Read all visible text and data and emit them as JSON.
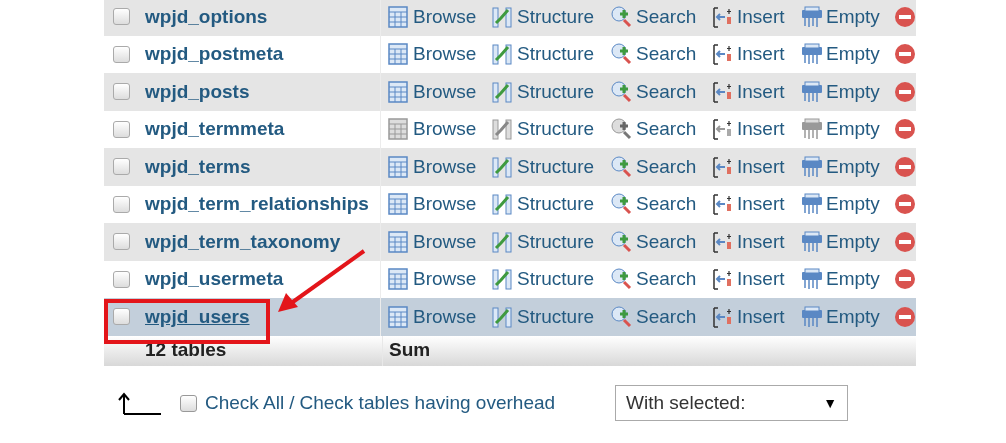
{
  "tables": [
    {
      "name": "wpjd_options",
      "checked": false,
      "empty": false,
      "highlighted": false,
      "actions": [
        "Browse",
        "Structure",
        "Search",
        "Insert",
        "Empty"
      ]
    },
    {
      "name": "wpjd_postmeta",
      "checked": false,
      "empty": false,
      "highlighted": false,
      "actions": [
        "Browse",
        "Structure",
        "Search",
        "Insert",
        "Empty"
      ]
    },
    {
      "name": "wpjd_posts",
      "checked": false,
      "empty": false,
      "highlighted": false,
      "actions": [
        "Browse",
        "Structure",
        "Search",
        "Insert",
        "Empty"
      ]
    },
    {
      "name": "wpjd_termmeta",
      "checked": false,
      "empty": true,
      "highlighted": false,
      "actions": [
        "Browse",
        "Structure",
        "Search",
        "Insert",
        "Empty"
      ]
    },
    {
      "name": "wpjd_terms",
      "checked": false,
      "empty": false,
      "highlighted": false,
      "actions": [
        "Browse",
        "Structure",
        "Search",
        "Insert",
        "Empty"
      ]
    },
    {
      "name": "wpjd_term_relationships",
      "checked": false,
      "empty": false,
      "highlighted": false,
      "actions": [
        "Browse",
        "Structure",
        "Search",
        "Insert",
        "Empty"
      ]
    },
    {
      "name": "wpjd_term_taxonomy",
      "checked": false,
      "empty": false,
      "highlighted": false,
      "actions": [
        "Browse",
        "Structure",
        "Search",
        "Insert",
        "Empty"
      ]
    },
    {
      "name": "wpjd_usermeta",
      "checked": false,
      "empty": false,
      "highlighted": false,
      "actions": [
        "Browse",
        "Structure",
        "Search",
        "Insert",
        "Empty"
      ]
    },
    {
      "name": "wpjd_users",
      "checked": false,
      "empty": false,
      "highlighted": true,
      "actions": [
        "Browse",
        "Structure",
        "Search",
        "Insert",
        "Empty"
      ]
    }
  ],
  "footer": {
    "count": "12 tables",
    "sum": "Sum"
  },
  "bulk": {
    "check_all": "Check All",
    "separator": "/",
    "check_overhead": "Check tables having overhead",
    "checked": false,
    "select_value": "With selected:",
    "select_arrow": "▼"
  }
}
